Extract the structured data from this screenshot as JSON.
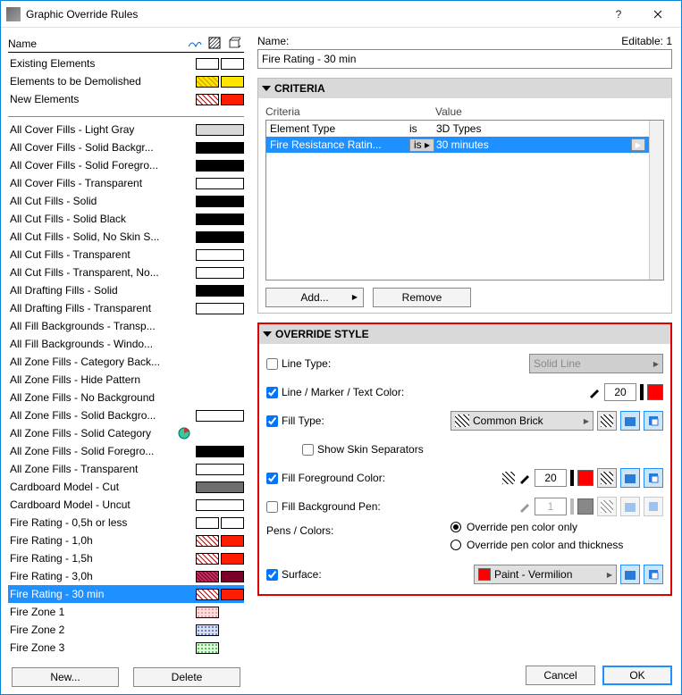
{
  "window": {
    "title": "Graphic Override Rules"
  },
  "left": {
    "header": "Name",
    "new_btn": "New...",
    "delete_btn": "Delete",
    "group1": [
      {
        "name": "Existing Elements",
        "sw1": "#ffffff",
        "sw2": "#ffffff"
      },
      {
        "name": "Elements to be Demolished",
        "sw1": "hatch-yellow",
        "sw2": "#ffe600"
      },
      {
        "name": "New Elements",
        "sw1": "hatch-red",
        "sw2": "#ff1c00"
      }
    ],
    "group2": [
      {
        "name": "All Cover Fills - Light Gray",
        "sw": "#d8d8d8"
      },
      {
        "name": "All Cover Fills - Solid Backgr...",
        "sw": "#000000"
      },
      {
        "name": "All Cover Fills - Solid Foregro...",
        "sw": "#000000"
      },
      {
        "name": "All Cover Fills - Transparent",
        "sw": "#ffffff"
      },
      {
        "name": "All Cut Fills - Solid",
        "sw": "#000000"
      },
      {
        "name": "All Cut Fills - Solid Black",
        "sw": "#000000"
      },
      {
        "name": "All Cut Fills - Solid, No Skin S...",
        "sw": "#000000"
      },
      {
        "name": "All Cut Fills - Transparent",
        "sw": "#ffffff"
      },
      {
        "name": "All Cut Fills - Transparent, No...",
        "sw": "#ffffff"
      },
      {
        "name": "All Drafting Fills - Solid",
        "sw": "#000000"
      },
      {
        "name": "All Drafting Fills - Transparent",
        "sw": "#ffffff"
      },
      {
        "name": "All Fill Backgrounds - Transp...",
        "sw": ""
      },
      {
        "name": "All Fill Backgrounds - Windo...",
        "sw": ""
      },
      {
        "name": "All Zone Fills - Category Back...",
        "sw": ""
      },
      {
        "name": "All Zone Fills - Hide Pattern",
        "sw": ""
      },
      {
        "name": "All Zone Fills - No Background",
        "sw": ""
      },
      {
        "name": "All Zone Fills - Solid Backgro...",
        "sw": "#ffffff"
      },
      {
        "name": "All Zone Fills - Solid Category",
        "sw": "",
        "icon": "pie"
      },
      {
        "name": "All Zone Fills - Solid Foregro...",
        "sw": "#000000"
      },
      {
        "name": "All Zone Fills - Transparent",
        "sw": "#ffffff"
      },
      {
        "name": "Cardboard Model - Cut",
        "sw": "#6e6e6e"
      },
      {
        "name": "Cardboard Model - Uncut",
        "sw": "#ffffff"
      },
      {
        "name": "Fire Rating - 0,5h or less",
        "sw1": "#ffffff",
        "sw2": "#ffffff"
      },
      {
        "name": "Fire Rating - 1,0h",
        "sw1": "hatch-red",
        "sw2": "#ff1c00"
      },
      {
        "name": "Fire Rating - 1,5h",
        "sw1": "hatch-red",
        "sw2": "#ff1c00"
      },
      {
        "name": "Fire Rating - 3,0h",
        "sw1": "hatch-darkred",
        "sw2": "#7a002a"
      },
      {
        "name": "Fire Rating - 30 min",
        "sw1": "hatch-red",
        "sw2": "#ff1c00",
        "selected": true
      },
      {
        "name": "Fire Zone 1",
        "sw1": "dots-pink",
        "sw2": ""
      },
      {
        "name": "Fire Zone 2",
        "sw1": "dots-blue",
        "sw2": ""
      },
      {
        "name": "Fire Zone 3",
        "sw1": "dots-green",
        "sw2": ""
      }
    ]
  },
  "right": {
    "name_label": "Name:",
    "editable_label": "Editable: 1",
    "name_value": "Fire Rating - 30 min",
    "criteria_title": "CRITERIA",
    "criteria_head": {
      "c1": "Criteria",
      "c2": "",
      "c3": "Value"
    },
    "criteria_rows": [
      {
        "c1": "Element Type",
        "op": "is",
        "val": "3D Types"
      },
      {
        "c1": "Fire Resistance Ratin...",
        "op": "is",
        "val": "30 minutes",
        "selected": true
      }
    ],
    "add_btn": "Add...",
    "remove_btn": "Remove",
    "override_title": "OVERRIDE STYLE",
    "line_type": {
      "label": "Line Type:",
      "value": "Solid Line",
      "checked": false
    },
    "line_color": {
      "label": "Line / Marker / Text Color:",
      "pen": "20",
      "color": "#ff0000",
      "checked": true
    },
    "fill_type": {
      "label": "Fill Type:",
      "value": "Common Brick",
      "checked": true
    },
    "skin_sep": {
      "label": "Show Skin Separators",
      "checked": false
    },
    "fill_fg": {
      "label": "Fill Foreground Color:",
      "pen": "20",
      "color": "#ff0000",
      "checked": true
    },
    "fill_bg": {
      "label": "Fill Background Pen:",
      "pen": "1",
      "checked": false
    },
    "pens_label": "Pens / Colors:",
    "radio1": "Override pen color only",
    "radio2": "Override pen color and thickness",
    "surface": {
      "label": "Surface:",
      "value": "Paint - Vermilion",
      "checked": true,
      "color": "#ff0000"
    },
    "cancel": "Cancel",
    "ok": "OK"
  }
}
